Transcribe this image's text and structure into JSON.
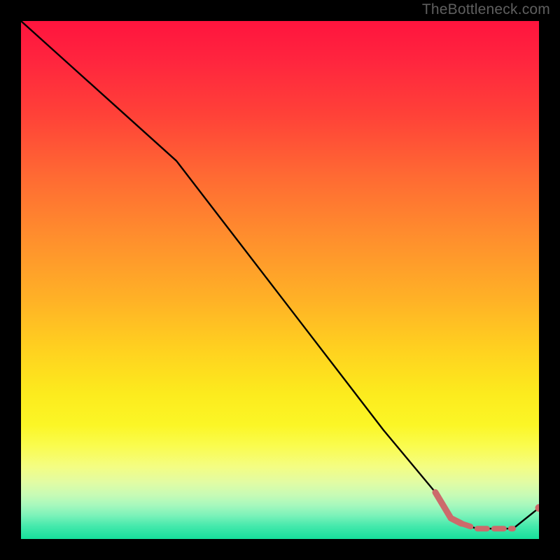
{
  "watermark": "TheBottleneck.com",
  "colors": {
    "page_bg": "#000000",
    "line": "#000000",
    "marker": "#cc6b6b",
    "watermark": "#5f5f5f"
  },
  "chart_data": {
    "type": "line",
    "title": "",
    "xlabel": "",
    "ylabel": "",
    "xlim": [
      0,
      100
    ],
    "ylim": [
      0,
      100
    ],
    "grid": false,
    "legend": false,
    "series": [
      {
        "name": "main-curve",
        "style": "solid",
        "x": [
          0,
          10,
          20,
          30,
          40,
          50,
          60,
          70,
          80,
          83,
          85,
          88,
          90,
          93,
          95,
          100
        ],
        "y": [
          100,
          91,
          82,
          73,
          60,
          47,
          34,
          21,
          9,
          4,
          3,
          2,
          2,
          2,
          2,
          6
        ]
      },
      {
        "name": "marker-segment",
        "style": "thick-dashed-marker",
        "x": [
          80,
          83,
          85,
          88,
          90,
          93,
          95,
          100
        ],
        "y": [
          9,
          4,
          3,
          2,
          2,
          2,
          2,
          6
        ]
      }
    ],
    "annotations": []
  }
}
